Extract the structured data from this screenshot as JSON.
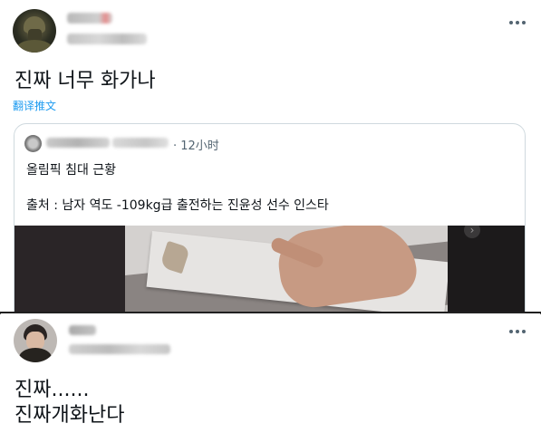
{
  "tweet1": {
    "text": "진짜 너무 화가나",
    "translate_label": "翻译推文",
    "quote": {
      "time": "· 12小时",
      "line1": "올림픽 침대 근황",
      "line2": "출처 : 남자 역도 -109kg급 출전하는 진윤성 선수 인스타"
    }
  },
  "tweet2": {
    "text_line1": "진짜......",
    "text_line2": "진짜개화난다"
  },
  "icons": {
    "more": "more-horizontal-icon",
    "media_next": "chevron-right-icon"
  },
  "colors": {
    "link": "#1d9bf0",
    "secondary_text": "#536471",
    "border": "#cfd9de"
  }
}
